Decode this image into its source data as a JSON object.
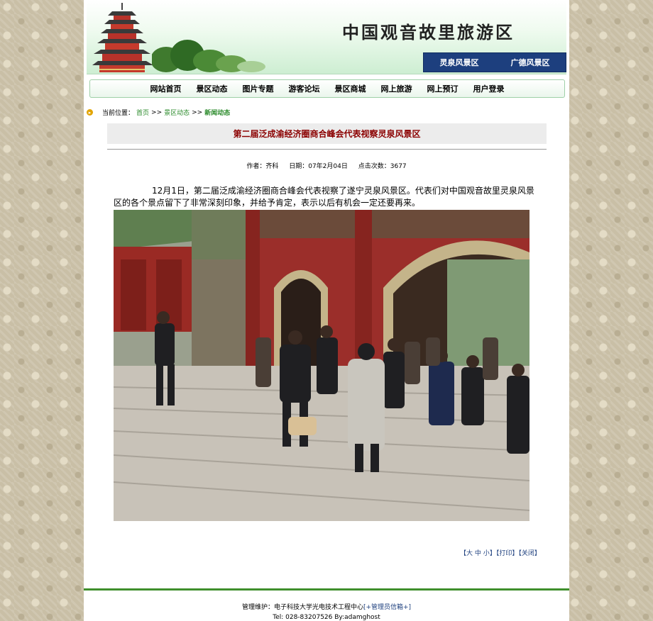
{
  "header": {
    "site_title": "中国观音故里旅游区",
    "scenic_links": [
      "灵泉风景区",
      "广德风景区"
    ]
  },
  "nav": [
    "网站首页",
    "景区动态",
    "图片专题",
    "游客论坛",
    "景区商城",
    "网上旅游",
    "网上预订",
    "用户登录"
  ],
  "breadcrumb": {
    "label": "当前位置：",
    "home": "首页",
    "sep": ">>",
    "section": "景区动态",
    "current": "新闻动态"
  },
  "article": {
    "title": "第二届泛成渝经济圈商合峰会代表视察灵泉风景区",
    "author": "作者：齐科",
    "date": "日期：07年2月04日",
    "views": "点击次数：3677",
    "body": "12月1日，第二届泛成渝经济圈商合峰会代表视察了遂宁灵泉风景区。代表们对中国观音故里灵泉风景区的各个景点留下了非常深刻印象，并给予肯定，表示以后有机会一定还要再来。"
  },
  "tools": {
    "open": "【",
    "big": "大",
    "mid": "中",
    "small": "小",
    "close_bracket": "】",
    "print": "【打印】",
    "close": "【关闭】"
  },
  "footer": {
    "maintainer": "管理维护：电子科技大学光电技术工程中心",
    "admin_mail": "[+管理员信箱+]",
    "tel": "Tel: 028-83207526 By:adamghost"
  },
  "colors": {
    "accent_blue": "#1d3f7e",
    "title_red": "#8b0000",
    "link_green": "#2a8a2a",
    "footer_green": "#3f8f2c"
  }
}
